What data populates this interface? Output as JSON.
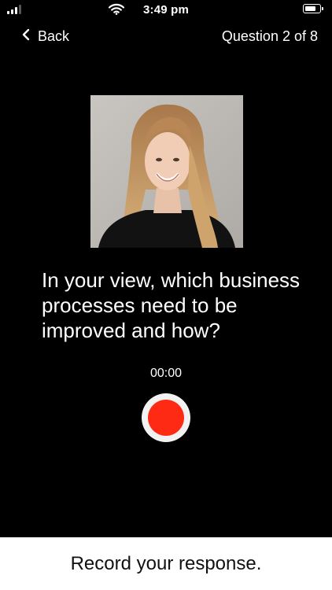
{
  "status_bar": {
    "time": "3:49 pm"
  },
  "nav": {
    "back_label": "Back",
    "question_count": "Question 2 of 8"
  },
  "question": {
    "text": "In your view, which business processes need to be improved and how?"
  },
  "recorder": {
    "timer": "00:00",
    "button_color": "#ff2a14"
  },
  "footer": {
    "instruction": "Record your response."
  },
  "colors": {
    "background": "#000000",
    "footer_background": "#ffffff"
  },
  "icons": {
    "signal": "signal-bars-icon",
    "wifi": "wifi-icon",
    "battery": "battery-icon",
    "back": "chevron-left-icon",
    "record": "record-icon"
  }
}
